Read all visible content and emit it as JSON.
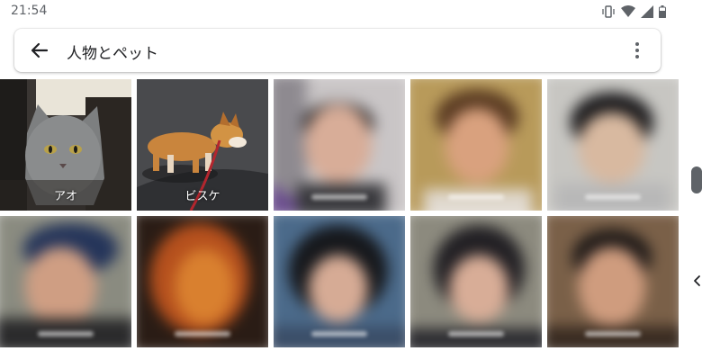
{
  "status_bar": {
    "time": "21:54",
    "icons": [
      "vibrate-icon",
      "wifi-icon",
      "signal-icon",
      "battery-icon"
    ]
  },
  "search_bar": {
    "title": "人物とペット",
    "back_icon": "arrow-back-icon",
    "menu_icon": "more-vert-icon"
  },
  "grid": {
    "tiles": [
      {
        "label": "アオ",
        "kind": "cat",
        "blurred": false
      },
      {
        "label": "ビスケ",
        "kind": "dog",
        "blurred": false
      },
      {
        "label": "",
        "kind": "face",
        "blurred": true
      },
      {
        "label": "",
        "kind": "face",
        "blurred": true
      },
      {
        "label": "",
        "kind": "face",
        "blurred": true
      },
      {
        "label": "",
        "kind": "face",
        "blurred": true
      },
      {
        "label": "",
        "kind": "face",
        "blurred": true
      },
      {
        "label": "",
        "kind": "face",
        "blurred": true
      },
      {
        "label": "",
        "kind": "face",
        "blurred": true
      },
      {
        "label": "",
        "kind": "face",
        "blurred": true
      }
    ]
  },
  "colors": {
    "text_primary": "#202124",
    "text_secondary": "#5f6368",
    "accent": "#ffffff"
  }
}
